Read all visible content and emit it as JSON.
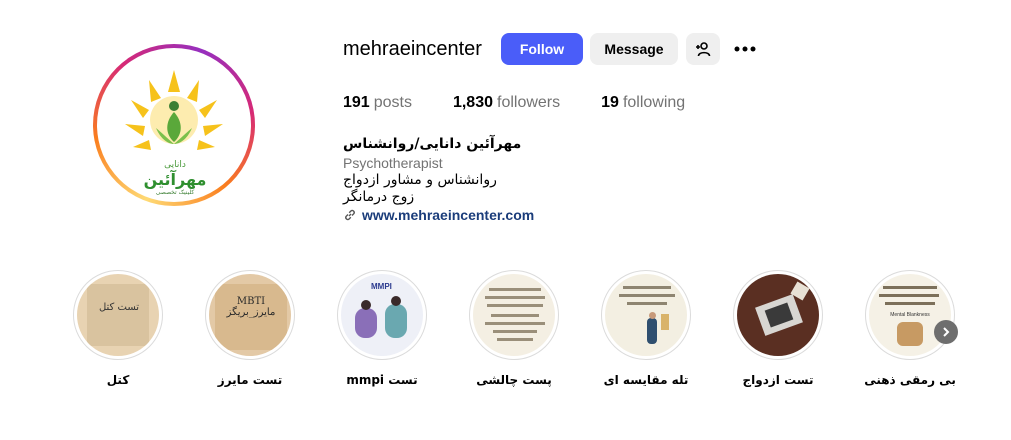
{
  "profile": {
    "username": "mehraeincenter",
    "follow_label": "Follow",
    "message_label": "Message",
    "add_user_icon": "add-user-icon",
    "more_icon": "more-options-icon",
    "logo_text": {
      "line1": "دانایی",
      "line2": "مهرآئین",
      "line3": "کلینیک تخصصی"
    }
  },
  "stats": {
    "posts_count": "191",
    "posts_label": "posts",
    "followers_count": "1,830",
    "followers_label": "followers",
    "following_count": "19",
    "following_label": "following"
  },
  "bio": {
    "name": "مهرآئین دانایی/روانشناس",
    "category": "Psychotherapist",
    "line1": "روانشناس و مشاور ازدواج",
    "line2": "زوج درمانگر",
    "link": "www.mehraeincenter.com",
    "link_icon": "link-icon"
  },
  "highlights": [
    {
      "label": "کتل",
      "cover_text": "تست کتل"
    },
    {
      "label": "تست مایرز",
      "cover_text": "MBTI مایرز_بریگز"
    },
    {
      "label": "تست mmpi",
      "cover_text": "MMPI"
    },
    {
      "label": "پست چالشی",
      "cover_text": ""
    },
    {
      "label": "تله مقایسه ای",
      "cover_text": ""
    },
    {
      "label": "تست ازدواج",
      "cover_text": ""
    },
    {
      "label": "بی رمقی ذهنی",
      "cover_text": "Mental Blankness"
    }
  ],
  "colors": {
    "follow_button": "#4a5df9",
    "secondary_button": "#efefef",
    "muted_text": "#737373",
    "link_text": "#1a3c7a"
  },
  "next_icon": "chevron-right-icon"
}
